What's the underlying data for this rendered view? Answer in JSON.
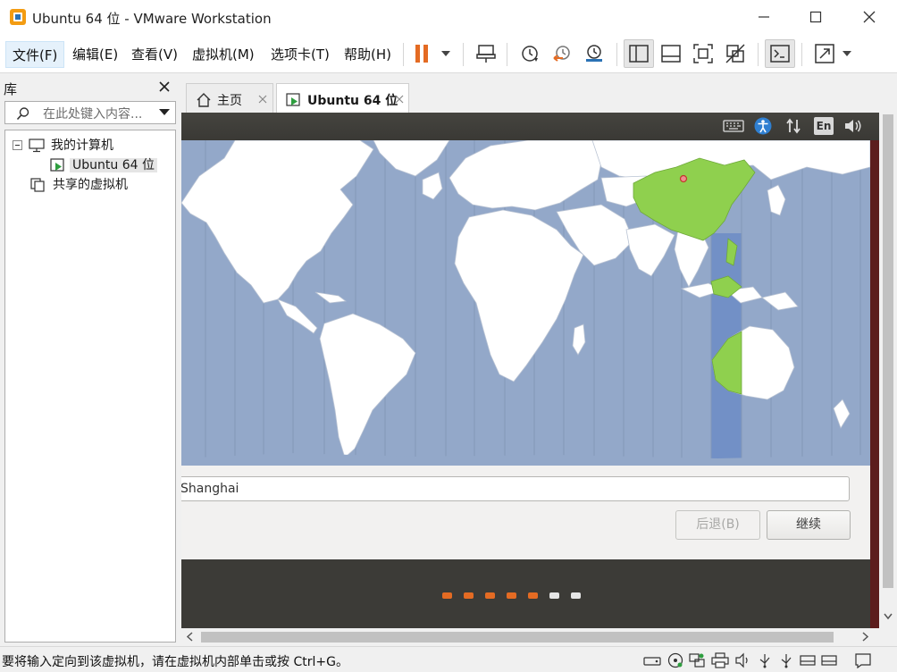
{
  "window": {
    "title": "Ubuntu 64 位 - VMware Workstation"
  },
  "menu": [
    "文件(F)",
    "编辑(E)",
    "查看(V)",
    "虚拟机(M)",
    "选项卡(T)",
    "帮助(H)"
  ],
  "library": {
    "title": "库",
    "search_placeholder": "在此处键入内容...",
    "tree": [
      "我的计算机",
      "Ubuntu 64 位",
      "共享的虚拟机"
    ]
  },
  "tabs": [
    "主页",
    "Ubuntu 64 位"
  ],
  "ubuntu": {
    "lang_indicator": "En",
    "timezone_value": "Shanghai",
    "back_button": "后退(B)",
    "continue_button": "继续",
    "progress": {
      "total_steps": 7,
      "completed_steps": 5
    }
  },
  "status": {
    "message": "要将输入定向到该虚拟机，请在虚拟机内部单击或按 Ctrl+G。"
  },
  "colors": {
    "accent": "#e46b23",
    "ocean": "#93a8c9",
    "timezone_band": "#7290c6",
    "selected_region": "#8fd04e",
    "ubuntu_panel": "#3c3b37"
  }
}
